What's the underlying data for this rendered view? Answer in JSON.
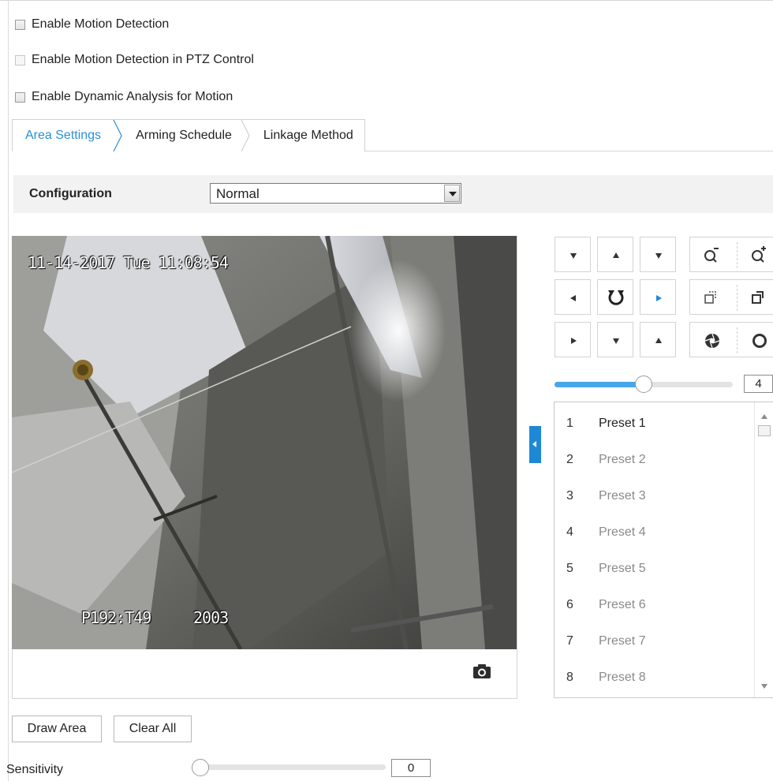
{
  "options": {
    "enable_motion_detection": "Enable Motion Detection",
    "enable_motion_detection_ptz": "Enable Motion Detection in PTZ Control",
    "enable_dynamic_analysis": "Enable Dynamic Analysis for Motion"
  },
  "tabs": [
    {
      "label": "Area Settings",
      "active": true
    },
    {
      "label": "Arming Schedule",
      "active": false
    },
    {
      "label": "Linkage Method",
      "active": false
    }
  ],
  "configuration": {
    "label": "Configuration",
    "selected": "Normal"
  },
  "video": {
    "timestamp": "11-14-2017 Tue 11:08:54",
    "camera_id_left": "P192:T49",
    "camera_id_right": "2003"
  },
  "ptz": {
    "speed_value": "4",
    "speed_fraction": 0.5
  },
  "presets": [
    {
      "number": "1",
      "label": "Preset 1"
    },
    {
      "number": "2",
      "label": "Preset 2"
    },
    {
      "number": "3",
      "label": "Preset 3"
    },
    {
      "number": "4",
      "label": "Preset 4"
    },
    {
      "number": "5",
      "label": "Preset 5"
    },
    {
      "number": "6",
      "label": "Preset 6"
    },
    {
      "number": "7",
      "label": "Preset 7"
    },
    {
      "number": "8",
      "label": "Preset 8"
    }
  ],
  "actions": {
    "draw_area": "Draw Area",
    "clear_all": "Clear All"
  },
  "sensitivity": {
    "label": "Sensitivity",
    "value": "0",
    "fraction": 0
  },
  "colors": {
    "accent": "#1f88d6",
    "slider_fill": "#49a6ea",
    "active_tab_text": "#2a8fd9"
  }
}
